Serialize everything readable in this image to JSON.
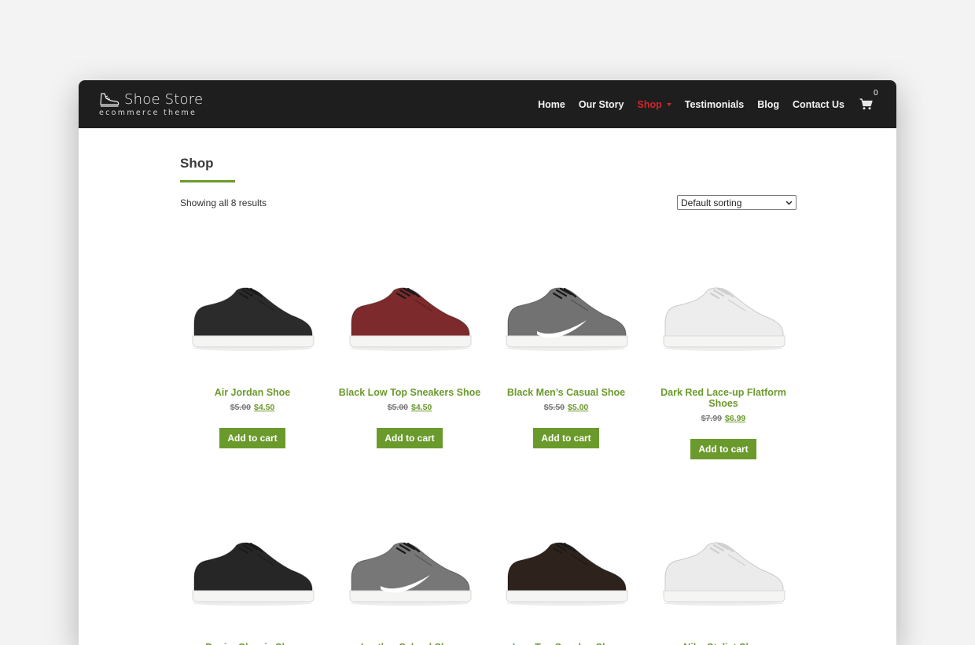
{
  "brand": {
    "name": "Shoe Store",
    "tagline": "ecommerce theme"
  },
  "nav": {
    "items": [
      {
        "label": "Home",
        "active": false
      },
      {
        "label": "Our Story",
        "active": false
      },
      {
        "label": "Shop",
        "active": true
      },
      {
        "label": "Testimonials",
        "active": false
      },
      {
        "label": "Blog",
        "active": false
      },
      {
        "label": "Contact Us",
        "active": false
      }
    ],
    "cart_count": "0",
    "cart_icon": "cart-icon"
  },
  "page": {
    "title": "Shop",
    "result_count": "Showing all 8 results",
    "sort_selected": "Default sorting"
  },
  "products": [
    {
      "name": "Air Jordan Shoe",
      "old_price": "$5.00",
      "new_price": "$4.50",
      "button": "Add to cart",
      "color": "#2b2b2b"
    },
    {
      "name": "Black Low Top Sneakers Shoe",
      "old_price": "$5.00",
      "new_price": "$4.50",
      "button": "Add to cart",
      "color": "#7d2a2c"
    },
    {
      "name": "Black Men’s Casual Shoe",
      "old_price": "$5.50",
      "new_price": "$5.00",
      "button": "Add to cart",
      "color": "#727272"
    },
    {
      "name": "Dark Red Lace-up Flatform Shoes",
      "old_price": "$7.99",
      "new_price": "$6.99",
      "button": "Add to cart",
      "color": "#ededed"
    },
    {
      "name": "Denim Classic Shoe",
      "old_price": "",
      "new_price": "",
      "button": "",
      "color": "#262626"
    },
    {
      "name": "Leather School Shoe",
      "old_price": "",
      "new_price": "",
      "button": "",
      "color": "#777777"
    },
    {
      "name": "Low Top Sneaker Shoe",
      "old_price": "",
      "new_price": "",
      "button": "",
      "color": "#2d221c"
    },
    {
      "name": "Nike Stylist Shoe",
      "old_price": "",
      "new_price": "",
      "button": "",
      "color": "#ebebeb"
    }
  ],
  "colors": {
    "accent": "#6b9a2c",
    "nav_active": "#d0262c",
    "topbar": "#1e1e1e"
  }
}
